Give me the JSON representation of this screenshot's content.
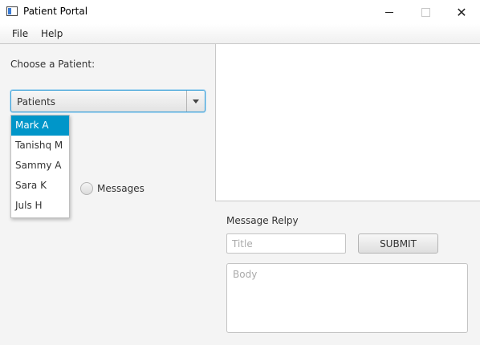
{
  "window": {
    "title": "Patient Portal",
    "controls": {
      "minimize": "minimize-icon",
      "maximize": "maximize-icon",
      "close": "close-icon",
      "close_glyph": "✕"
    }
  },
  "menu": {
    "file": "File",
    "help": "Help"
  },
  "patient_selector": {
    "label": "Choose a Patient:",
    "combo_value": "Patients",
    "options": [
      "Mark A",
      "Tanishq M",
      "Sammy A",
      "Sara K",
      "Juls H"
    ],
    "highlighted_option": "Mark A"
  },
  "view_toggle": {
    "messages_label": "Messages",
    "messages_selected": false
  },
  "reply": {
    "label": "Message Relpy",
    "title_placeholder": "Title",
    "title_value": "",
    "submit_label": "SUBMIT",
    "body_placeholder": "Body",
    "body_value": ""
  },
  "colors": {
    "selection": "#0096c9",
    "focus_border": "#3aa0d8",
    "background": "#f4f4f4"
  }
}
